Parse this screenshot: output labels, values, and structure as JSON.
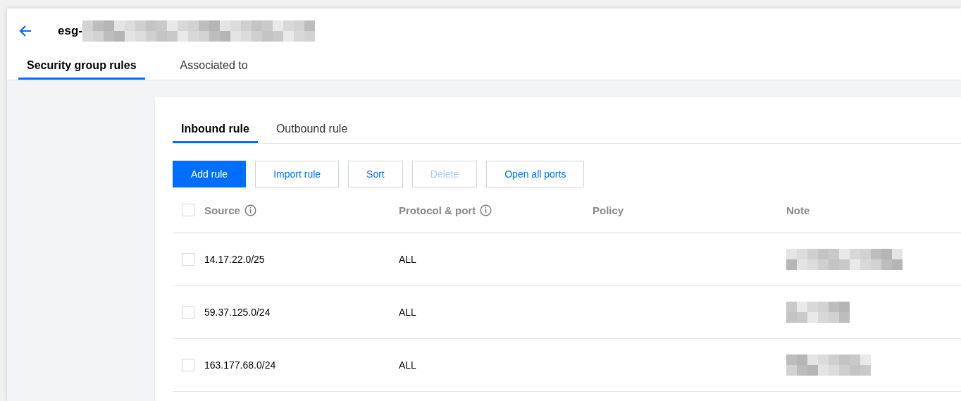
{
  "header": {
    "title": "esg-"
  },
  "tabs": [
    {
      "label": "Security group rules",
      "selected": true
    },
    {
      "label": "Associated to",
      "selected": false
    }
  ],
  "rule_tabs": [
    {
      "label": "Inbound rule",
      "selected": true
    },
    {
      "label": "Outbound rule",
      "selected": false
    }
  ],
  "buttons": [
    {
      "label": "Add rule",
      "kind": "primary",
      "disabled": false
    },
    {
      "label": "Import rule",
      "kind": "default",
      "disabled": false
    },
    {
      "label": "Sort",
      "kind": "default",
      "disabled": false
    },
    {
      "label": "Delete",
      "kind": "default",
      "disabled": true
    },
    {
      "label": "Open all ports",
      "kind": "default",
      "disabled": false
    }
  ],
  "table": {
    "select_all": {
      "checked": false
    },
    "columns": [
      {
        "label": "Source",
        "info": true
      },
      {
        "label": "Protocol & port",
        "info": true
      },
      {
        "label": "Policy",
        "info": false
      },
      {
        "label": "Note",
        "info": false
      }
    ],
    "rows": [
      {
        "checked": false,
        "source": "14.17.22.0/25",
        "protocol": "ALL"
      },
      {
        "checked": false,
        "source": "59.37.125.0/24",
        "protocol": "ALL"
      },
      {
        "checked": false,
        "source": "163.177.68.0/24",
        "protocol": "ALL"
      }
    ]
  }
}
